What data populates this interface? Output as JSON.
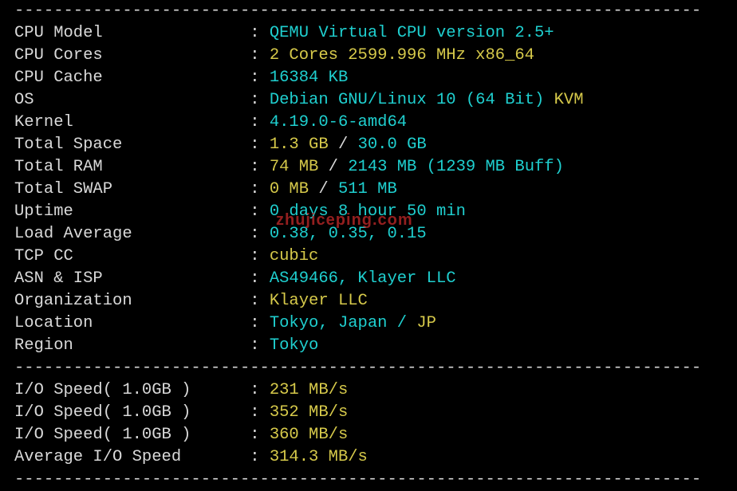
{
  "divider": "----------------------------------------------------------------------",
  "sepchar": ": ",
  "rows": [
    {
      "label": "CPU Model",
      "parts": [
        {
          "t": "QEMU Virtual CPU version 2.5+",
          "c": "cyan"
        }
      ]
    },
    {
      "label": "CPU Cores",
      "parts": [
        {
          "t": "2 Cores 2599.996 MHz x86_64",
          "c": "yellow"
        }
      ]
    },
    {
      "label": "CPU Cache",
      "parts": [
        {
          "t": "16384 KB",
          "c": "cyan"
        }
      ]
    },
    {
      "label": "OS",
      "parts": [
        {
          "t": "Debian GNU/Linux 10 (64 Bit) ",
          "c": "cyan"
        },
        {
          "t": "KVM",
          "c": "yellow"
        }
      ]
    },
    {
      "label": "Kernel",
      "parts": [
        {
          "t": "4.19.0-6-amd64",
          "c": "cyan"
        }
      ]
    },
    {
      "label": "Total Space",
      "parts": [
        {
          "t": "1.3 GB ",
          "c": "yellow"
        },
        {
          "t": "/ ",
          "c": "white"
        },
        {
          "t": "30.0 GB",
          "c": "cyan"
        }
      ]
    },
    {
      "label": "Total RAM",
      "parts": [
        {
          "t": "74 MB ",
          "c": "yellow"
        },
        {
          "t": "/ ",
          "c": "white"
        },
        {
          "t": "2143 MB ",
          "c": "cyan"
        },
        {
          "t": "(1239 MB Buff)",
          "c": "cyan"
        }
      ]
    },
    {
      "label": "Total SWAP",
      "parts": [
        {
          "t": "0 MB ",
          "c": "yellow"
        },
        {
          "t": "/ ",
          "c": "white"
        },
        {
          "t": "511 MB",
          "c": "cyan"
        }
      ]
    },
    {
      "label": "Uptime",
      "parts": [
        {
          "t": "0 days 8 hour 50 min",
          "c": "cyan"
        }
      ]
    },
    {
      "label": "Load Average",
      "parts": [
        {
          "t": "0.38, 0.35, 0.15",
          "c": "cyan"
        }
      ]
    },
    {
      "label": "TCP CC",
      "parts": [
        {
          "t": "cubic",
          "c": "yellow"
        }
      ]
    },
    {
      "label": "ASN & ISP",
      "parts": [
        {
          "t": "AS49466, Klayer LLC",
          "c": "cyan"
        }
      ]
    },
    {
      "label": "Organization",
      "parts": [
        {
          "t": "Klayer LLC",
          "c": "yellow"
        }
      ]
    },
    {
      "label": "Location",
      "parts": [
        {
          "t": "Tokyo, Japan / ",
          "c": "cyan"
        },
        {
          "t": "JP",
          "c": "yellow"
        }
      ]
    },
    {
      "label": "Region",
      "parts": [
        {
          "t": "Tokyo",
          "c": "cyan"
        }
      ]
    }
  ],
  "io_rows": [
    {
      "label": "I/O Speed( 1.0GB )",
      "parts": [
        {
          "t": "231 MB/s",
          "c": "yellow"
        }
      ]
    },
    {
      "label": "I/O Speed( 1.0GB )",
      "parts": [
        {
          "t": "352 MB/s",
          "c": "yellow"
        }
      ]
    },
    {
      "label": "I/O Speed( 1.0GB )",
      "parts": [
        {
          "t": "360 MB/s",
          "c": "yellow"
        }
      ]
    },
    {
      "label": "Average I/O Speed",
      "parts": [
        {
          "t": "314.3 MB/s",
          "c": "yellow"
        }
      ]
    }
  ],
  "watermark": "zhujiceping.com"
}
